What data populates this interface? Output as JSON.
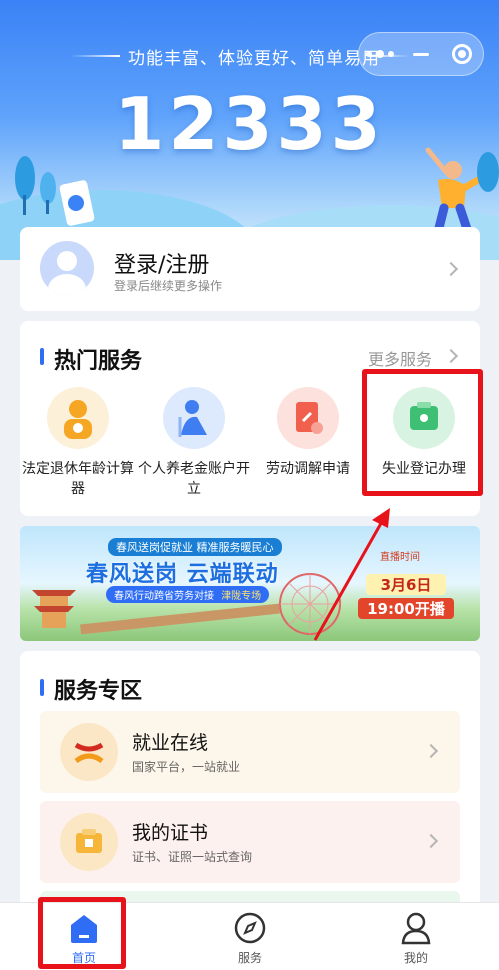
{
  "header": {
    "slogan": "功能丰富、体验更好、简单易用",
    "number": "12333",
    "capsule_icons": [
      "more-dots-icon",
      "minimize-icon",
      "close-target-icon"
    ]
  },
  "login": {
    "title": "登录/注册",
    "subtitle": "登录后继续更多操作"
  },
  "hot_services": {
    "title": "热门服务",
    "more": "更多服务",
    "items": [
      {
        "label": "法定退休年龄计算器",
        "icon": "retirement-calculator-icon"
      },
      {
        "label": "个人养老金账户开立",
        "icon": "pension-account-icon"
      },
      {
        "label": "劳动调解申请",
        "icon": "labor-mediation-icon"
      },
      {
        "label": "失业登记办理",
        "icon": "unemployment-registration-icon"
      }
    ]
  },
  "banner": {
    "top_text": "春风送岗促就业  精准服务暖民心",
    "headline": "春风送岗 云端联动",
    "ribbon": "春风行动跨省劳务对接",
    "ribbon_tag": "津陇专场",
    "live_label": "直播时间",
    "date": "3月6日",
    "time": "19:00开播"
  },
  "service_zone": {
    "title": "服务专区",
    "items": [
      {
        "title": "就业在线",
        "subtitle": "国家平台，一站就业",
        "icon": "employment-online-icon"
      },
      {
        "title": "我的证书",
        "subtitle": "证书、证照一站式查询",
        "icon": "certificate-icon"
      }
    ]
  },
  "tabbar": {
    "items": [
      {
        "label": "首页",
        "icon": "home-icon",
        "active": true
      },
      {
        "label": "服务",
        "icon": "compass-icon",
        "active": false
      },
      {
        "label": "我的",
        "icon": "user-icon",
        "active": false
      }
    ]
  },
  "colors": {
    "accent": "#2f6df5",
    "highlight_box": "#e8121b"
  }
}
